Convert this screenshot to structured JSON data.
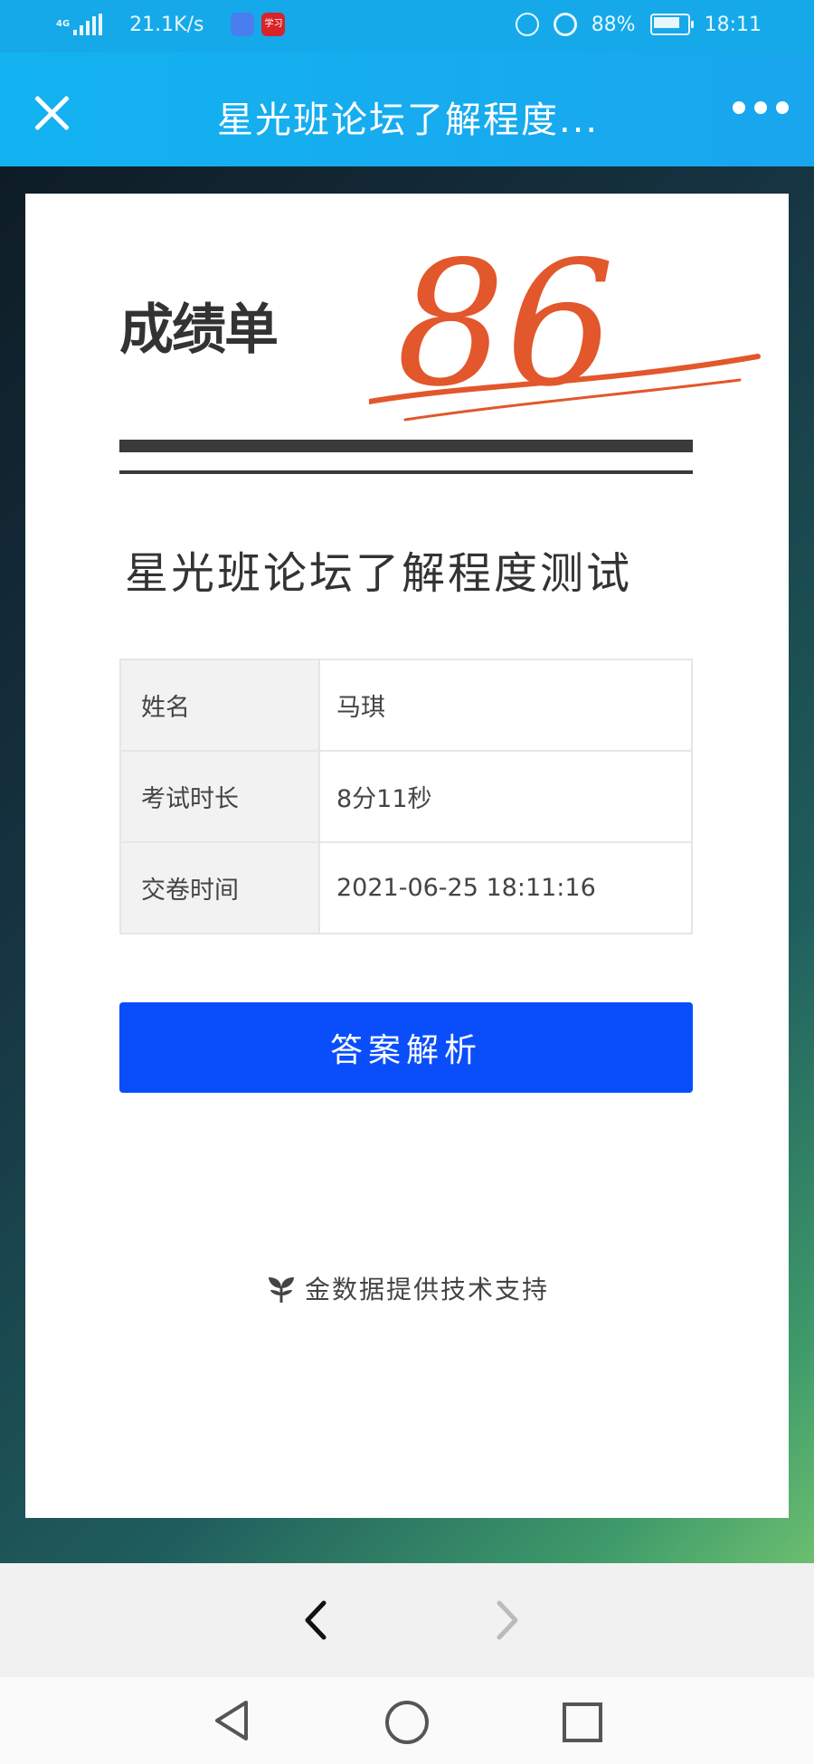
{
  "status_bar": {
    "network": "4G",
    "speed": "21.1K/s",
    "battery_text": "88%",
    "battery_level": 0.88,
    "time": "18:11",
    "icons": [
      "signal-icon",
      "music-app-icon",
      "xuexi-app-icon",
      "hd-call-icon",
      "alarm-icon",
      "battery-icon"
    ],
    "xuexi_label": "学习"
  },
  "title_bar": {
    "title": "星光班论坛了解程度..."
  },
  "result_card": {
    "heading": "成绩单",
    "score": "86",
    "exam_title": "星光班论坛了解程度测试",
    "rows": [
      {
        "label": "姓名",
        "value": "马琪"
      },
      {
        "label": "考试时长",
        "value": "8分11秒"
      },
      {
        "label": "交卷时间",
        "value": "2021-06-25 18:11:16"
      }
    ],
    "button_label": "答案解析",
    "footer": "金数据提供技术支持"
  },
  "colors": {
    "header_blue": "#15a9e9",
    "button_blue": "#0a4efb",
    "score_red": "#e2572b"
  }
}
